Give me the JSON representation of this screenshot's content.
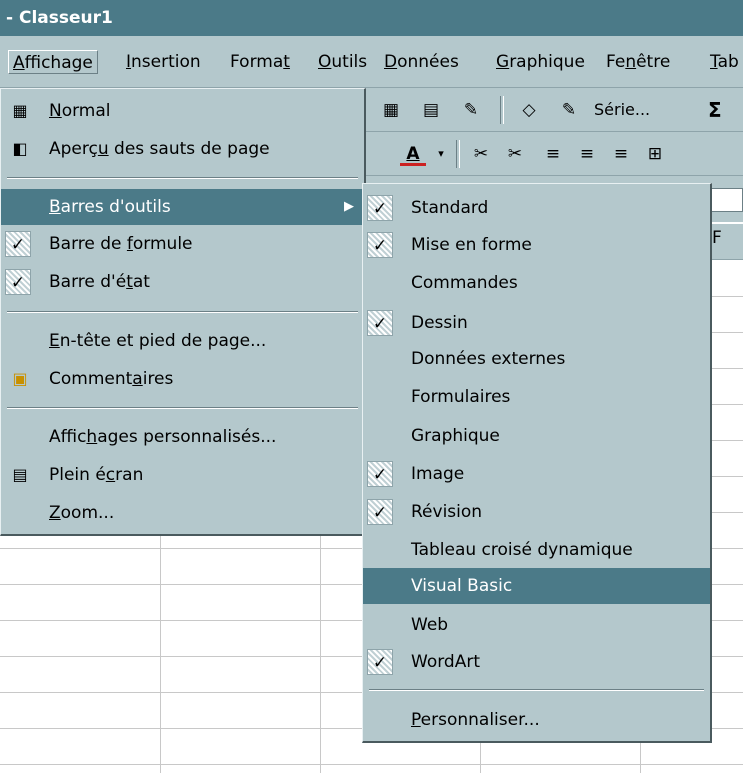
{
  "window": {
    "title": "- Classeur1"
  },
  "menubar": [
    {
      "label": "Affichage",
      "active": true
    },
    {
      "label": "Insertion"
    },
    {
      "label": "Format"
    },
    {
      "label": "Outils"
    },
    {
      "label": "Données"
    },
    {
      "label": "Graphique"
    },
    {
      "label": "Fenêtre"
    },
    {
      "label": "Tab"
    }
  ],
  "toolbar1": {
    "serie_label": "Série...",
    "sigma": "Σ"
  },
  "colheader": {
    "visible_letter": "F"
  },
  "affichage_menu": {
    "normal": "Normal",
    "apercu": "Aperçu des sauts de page",
    "barres_outils": "Barres d'outils",
    "barre_formule": "Barre de formule",
    "barre_etat": "Barre d'état",
    "entete": "En-tête et pied de page...",
    "commentaires": "Commentaires",
    "affichages_perso": "Affichages personnalisés...",
    "plein_ecran": "Plein écran",
    "zoom": "Zoom..."
  },
  "toolbars_submenu": {
    "standard": "Standard",
    "mise_en_forme": "Mise en forme",
    "commandes": "Commandes",
    "dessin": "Dessin",
    "donnees_externes": "Données externes",
    "formulaires": "Formulaires",
    "graphique": "Graphique",
    "image": "Image",
    "revision": "Révision",
    "tableau_croise": "Tableau croisé dynamique",
    "visual_basic": "Visual Basic",
    "web": "Web",
    "wordart": "WordArt",
    "personnaliser": "Personnaliser..."
  },
  "colors": {
    "highlight": "#4b7a88",
    "menu_bg": "#b4c8cc",
    "accent_red": "#cc2222"
  }
}
